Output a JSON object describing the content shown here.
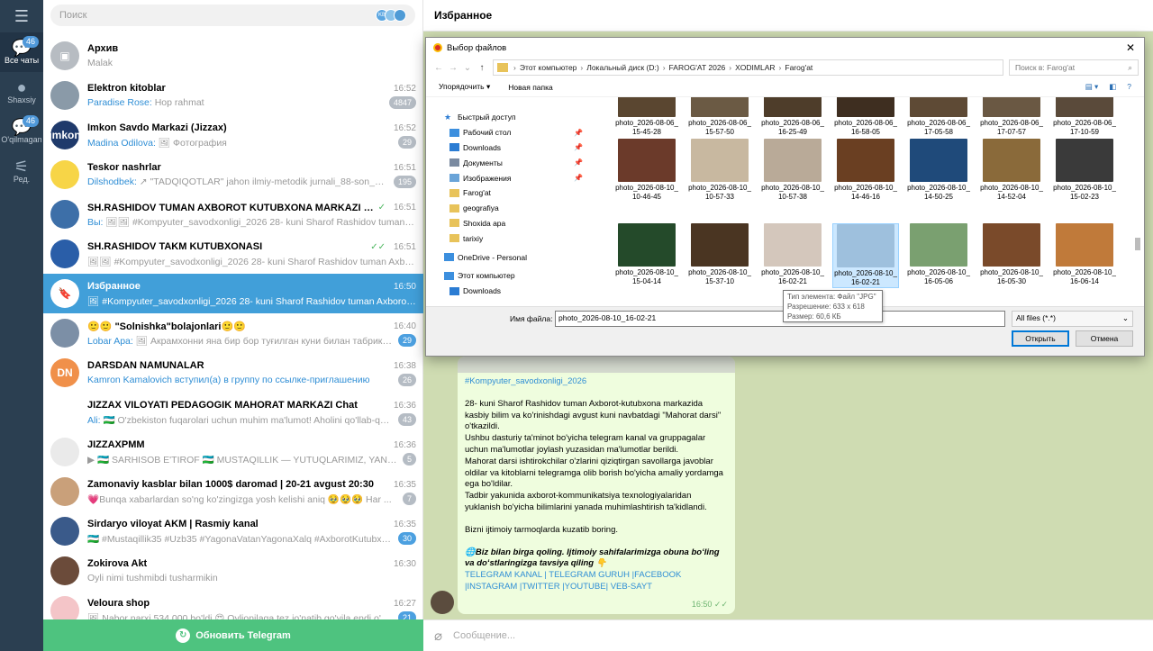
{
  "rail": {
    "items": [
      {
        "label": "Все чаты",
        "badge": "46",
        "icon": "chat-bubbles-icon",
        "active": true
      },
      {
        "label": "Shaxsiy",
        "badge": "",
        "icon": "person-icon"
      },
      {
        "label": "O'qilmagan",
        "badge": "46",
        "icon": "chat-bubble-icon"
      },
      {
        "label": "Ред.",
        "badge": "",
        "icon": "sliders-icon"
      }
    ]
  },
  "search": {
    "placeholder": "Поиск",
    "dots": [
      "KB",
      "",
      ""
    ]
  },
  "chats": [
    {
      "name": "Архив",
      "time": "",
      "sender": "",
      "preview": "Malak",
      "badge": "",
      "badge_color": "",
      "ticks": "",
      "avatar": "#b7bcc2",
      "avatar_text": "▣"
    },
    {
      "name": "Elektron kitoblar",
      "time": "16:52",
      "sender": "Paradise Rose:",
      "preview": "Hop rahmat",
      "badge": "4847",
      "badge_color": "grey",
      "ticks": "",
      "avatar": "#8a9aa8",
      "avatar_text": ""
    },
    {
      "name": "Imkon Savdo Markazi (Jizzax)",
      "time": "16:52",
      "sender": "Madina Odilova:",
      "preview": "🖼 Фотография",
      "badge": "29",
      "badge_color": "grey",
      "ticks": "",
      "avatar": "#1f3a6b",
      "avatar_text": "imkon"
    },
    {
      "name": "Teskor nashrlar",
      "time": "16:51",
      "sender": "Dilshodbek:",
      "preview": "↗ \"TADQIQOTLAR\" jahon ilmiy-metodik jurnali_88-son_7-qism ...",
      "badge": "195",
      "badge_color": "grey",
      "ticks": "",
      "avatar": "#f7d547",
      "avatar_text": ""
    },
    {
      "name": "SH.RASHIDOV TUMAN AXBOROT KUTUBXONA MARKAZI 📚 \"Oltin ye...",
      "time": "16:51",
      "sender": "Вы:",
      "preview": "🖼🖼 #Kompyuter_savodxonligi_2026 28- kuni Sharof Rashidov tuman Axb...",
      "badge": "",
      "badge_color": "",
      "ticks": "✓",
      "avatar": "#3d6fa8",
      "avatar_text": ""
    },
    {
      "name": "SH.RASHIDOV TAKM KUTUBXONASI",
      "time": "16:51",
      "sender": "",
      "preview": "🖼🖼 #Kompyuter_savodxonligi_2026 28- kuni Sharof Rashidov tuman Axborot-...",
      "badge": "",
      "badge_color": "",
      "ticks": "✓✓",
      "avatar": "#2a5ea8",
      "avatar_text": ""
    },
    {
      "name": "Избранное",
      "time": "16:50",
      "sender": "",
      "preview": "🖼 #Kompyuter_savodxonligi_2026 28- kuni Sharof Rashidov tuman Axborot-...",
      "badge": "",
      "badge_color": "",
      "ticks": "",
      "avatar": "#ffffff",
      "avatar_text": "🔖",
      "selected": true
    },
    {
      "name": "🙂🙂 \"Solnishka\"bolajonlari🙂🙂",
      "time": "16:40",
      "sender": "Lobar Apa:",
      "preview": "🖼 Акрамхонни яна бир бор туғилган куни билан табриклемиз ...",
      "badge": "29",
      "badge_color": "blue",
      "ticks": "",
      "avatar": "#7c8fa6",
      "avatar_text": ""
    },
    {
      "name": "DARSDAN NAMUNALAR",
      "time": "16:38",
      "sender": "Kamron Kamalovich вступил(а) в группу по ссылке-приглашению",
      "preview": "",
      "badge": "26",
      "badge_color": "grey",
      "ticks": "",
      "avatar": "#f0904a",
      "avatar_text": "DN"
    },
    {
      "name": "JIZZAX VILOYATI PEDAGOGIK MAHORAT MARKAZI Chat",
      "time": "16:36",
      "sender": "Ali:",
      "preview": "🇺🇿 O'zbekiston fuqarolari uchun muhim ma'lumot! Aholini qo'llab-quvvatla...",
      "badge": "43",
      "badge_color": "grey",
      "ticks": "",
      "avatar": "#ffffff",
      "avatar_text": ""
    },
    {
      "name": "JIZZAXPMM",
      "time": "16:36",
      "sender": "",
      "preview": "▶ 🇺🇿 SARHISOB E'TIROF 🇺🇿 MUSTAQILLIK — YUTUQLARIMIZ, YANGI MAQS...",
      "badge": "5",
      "badge_color": "grey",
      "ticks": "",
      "avatar": "#eaeaea",
      "avatar_text": ""
    },
    {
      "name": "Zamonaviy kasblar bilan 1000$ daromad | 20-21 avgust 20:30",
      "time": "16:35",
      "sender": "",
      "preview": "💗Bunqa xabarlardan so'ng ko'zingizga yosh kelishi aniq 🥹🥹🥹 Har ...",
      "badge": "7",
      "badge_color": "grey",
      "ticks": "",
      "avatar": "#c9a07a",
      "avatar_text": ""
    },
    {
      "name": "Sirdaryo viloyat AKM | Rasmiy kanal",
      "time": "16:35",
      "sender": "",
      "preview": "🇺🇿 #Mustaqillik35 #Uzb35 #YagonaVatanYagonaXalq #AxborotKutubxonaMark...",
      "badge": "30",
      "badge_color": "blue",
      "ticks": "",
      "avatar": "#3a5a8a",
      "avatar_text": ""
    },
    {
      "name": "Zokirova Akt",
      "time": "16:30",
      "sender": "",
      "preview": "Oyli nimi tushmibdi tusharmikin",
      "badge": "",
      "badge_color": "",
      "ticks": "",
      "avatar": "#6b4b3a",
      "avatar_text": ""
    },
    {
      "name": "Veloura shop",
      "time": "16:27",
      "sender": "",
      "preview": "🖼 Nabor narxi 534.000 bo'ldi 😍 Oyljonilaga tez jo'natib qo'yila endi o'pishga n...",
      "badge": "21",
      "badge_color": "blue",
      "ticks": "",
      "avatar": "#f4c5c8",
      "avatar_text": ""
    }
  ],
  "update": {
    "label": "Обновить Telegram"
  },
  "header": {
    "title": "Избранное"
  },
  "composer": {
    "placeholder": "Сообщение..."
  },
  "message": {
    "hashtag": "#Kompyuter_savodxonligi_2026",
    "lines": [
      "28- kuni Sharof Rashidov tuman  Axborot-kutubxona markazida kasbiy bilim va ko'rinishdagi avgust kuni navbatdagi \"Mahorat darsi\" o'tkazildi.",
      "Ushbu dasturiy ta'minot bo'yicha telegram kanal va gruppagalar uchun ma'lumotlar joylash yuzasidan ma'lumotlar berildi.",
      "Mahorat darsi ishtirokchilar o'zlarini qiziqtirgan savollarga javoblar oldilar va kitoblarni telegramga olib borish bo'yicha amaliy yordamga ega bo'ldilar.",
      "Tadbir yakunida axborot-kommunikatsiya texnologiyalaridan yuklanish bo'yicha bilimlarini yanada muhimlashtirish ta'kidlandi."
    ],
    "follow": "Bizni ijtimoiy tarmoqlarda kuzatib boring.",
    "cta": "🌐Biz bilan birga qoling. Ijtimoiy sahifalarimizga obuna boʻling va doʻstlaringizga tavsiya qiling 👇",
    "links": "   TELEGRAM KANAL | TELEGRAM GURUH |FACEBOOK |INSTAGRAM |TWITTER |YOUTUBE| VEB-SAYT",
    "time": "16:50"
  },
  "dialog": {
    "title": "Выбор файлов",
    "path": [
      "Этот компьютер",
      "Локальный диск (D:)",
      "FAROG'AT 2026",
      "XODIMLAR",
      "Farog'at"
    ],
    "search_placeholder": "Поиск в: Farog'at",
    "organize": "Упорядочить ▾",
    "new_folder": "Новая папка",
    "tree": [
      {
        "label": "Быстрый доступ",
        "icon": "star-icon",
        "color": "#2b7cd3",
        "pin": false,
        "sub": false
      },
      {
        "label": "Рабочий стол",
        "icon": "desktop-icon",
        "color": "#3c8fde",
        "pin": true,
        "sub": true
      },
      {
        "label": "Downloads",
        "icon": "download-icon",
        "color": "#2b7cd3",
        "pin": true,
        "sub": true
      },
      {
        "label": "Документы",
        "icon": "document-icon",
        "color": "#7a8aa0",
        "pin": true,
        "sub": true
      },
      {
        "label": "Изображения",
        "icon": "pictures-icon",
        "color": "#6aa4d8",
        "pin": true,
        "sub": true
      },
      {
        "label": "Farog'at",
        "icon": "folder-icon",
        "color": "#e8c35a",
        "pin": false,
        "sub": true
      },
      {
        "label": "geografiya",
        "icon": "folder-icon",
        "color": "#e8c35a",
        "pin": false,
        "sub": true
      },
      {
        "label": "Shoxida apa",
        "icon": "folder-icon",
        "color": "#e8c35a",
        "pin": false,
        "sub": true
      },
      {
        "label": "tarixiy",
        "icon": "folder-icon",
        "color": "#e8c35a",
        "pin": false,
        "sub": true
      },
      {
        "label": "OneDrive - Personal",
        "icon": "cloud-icon",
        "color": "#3c8fde",
        "pin": false,
        "sub": false
      },
      {
        "label": "Этот компьютер",
        "icon": "computer-icon",
        "color": "#3c8fde",
        "pin": false,
        "sub": false
      },
      {
        "label": "Downloads",
        "icon": "download-icon",
        "color": "#2b7cd3",
        "pin": false,
        "sub": true
      }
    ],
    "files": [
      {
        "name": "photo_2026-08-06_15-45-28",
        "color": "#5a4630"
      },
      {
        "name": "photo_2026-08-06_15-57-50",
        "color": "#6b5a44"
      },
      {
        "name": "photo_2026-08-06_16-25-49",
        "color": "#4e3d2a"
      },
      {
        "name": "photo_2026-08-06_16-58-05",
        "color": "#3e2e20"
      },
      {
        "name": "photo_2026-08-06_17-05-58",
        "color": "#5e4a35"
      },
      {
        "name": "photo_2026-08-06_17-07-57",
        "color": "#6a5843"
      },
      {
        "name": "photo_2026-08-06_17-10-59",
        "color": "#5a4a3a"
      },
      {
        "name": "photo_2026-08-10_10-46-45",
        "color": "#6b3a2a"
      },
      {
        "name": "photo_2026-08-10_10-57-33",
        "color": "#c8b8a0"
      },
      {
        "name": "photo_2026-08-10_10-57-38",
        "color": "#b9aa98"
      },
      {
        "name": "photo_2026-08-10_14-46-16",
        "color": "#6a3f22"
      },
      {
        "name": "photo_2026-08-10_14-50-25",
        "color": "#1f4a7a"
      },
      {
        "name": "photo_2026-08-10_14-52-04",
        "color": "#8a6a3a"
      },
      {
        "name": "photo_2026-08-10_15-02-23",
        "color": "#3a3a3a"
      },
      {
        "name": "photo_2026-08-10_15-04-14",
        "color": "#244a2a"
      },
      {
        "name": "photo_2026-08-10_15-37-10",
        "color": "#4a3522"
      },
      {
        "name": "photo_2026-08-10_16-02-21",
        "color": "#d4c7bc"
      },
      {
        "name": "photo_2026-08-10_16-02-21",
        "color": "#9ec0dd",
        "selected": true
      },
      {
        "name": "photo_2026-08-10_16-05-06",
        "color": "#7aa070"
      },
      {
        "name": "photo_2026-08-10_16-05-30",
        "color": "#7a4a2a"
      },
      {
        "name": "photo_2026-08-10_16-06-14",
        "color": "#c07a3a"
      }
    ],
    "tooltip": {
      "type": "Тип элемента: Файл \"JPG\"",
      "res": "Разрешение: 633 x 618",
      "size": "Размер: 60,6 КБ"
    },
    "filename_label": "Имя файла:",
    "filename_value": "photo_2026-08-10_16-02-21",
    "filetype": "All files (*.*)",
    "open": "Открыть",
    "cancel": "Отмена"
  }
}
